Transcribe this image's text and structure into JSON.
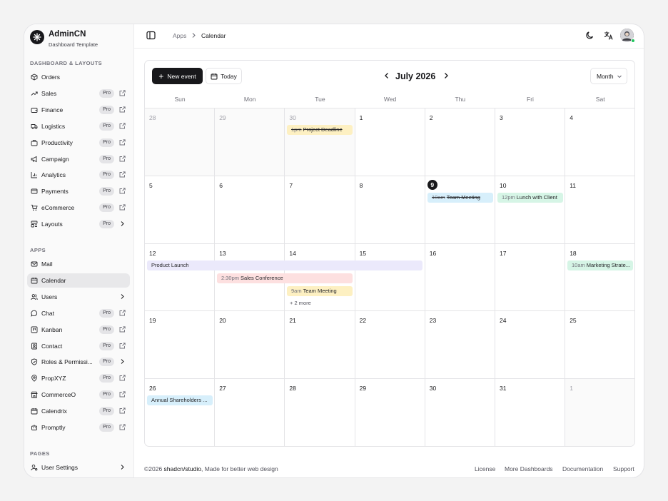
{
  "brand": {
    "name": "AdminCN",
    "subtitle": "Dashboard Template"
  },
  "sidebar": {
    "sections": [
      {
        "title": "DASHBOARD & LAYOUTS"
      },
      {
        "title": "APPS"
      },
      {
        "title": "PAGES"
      }
    ],
    "items": [
      {
        "label": "Orders",
        "icon": "package-icon"
      },
      {
        "label": "Sales",
        "icon": "trending-up-icon",
        "badge": "Pro"
      },
      {
        "label": "Finance",
        "icon": "wallet-icon",
        "badge": "Pro"
      },
      {
        "label": "Logistics",
        "icon": "truck-icon",
        "badge": "Pro"
      },
      {
        "label": "Productivity",
        "icon": "briefcase-icon",
        "badge": "Pro"
      },
      {
        "label": "Campaign",
        "icon": "megaphone-icon",
        "badge": "Pro"
      },
      {
        "label": "Analytics",
        "icon": "bar-chart-icon",
        "badge": "Pro"
      },
      {
        "label": "Payments",
        "icon": "credit-card-icon",
        "badge": "Pro"
      },
      {
        "label": "eCommerce",
        "icon": "cart-icon",
        "badge": "Pro"
      },
      {
        "label": "Layouts",
        "icon": "layout-icon",
        "badge": "Pro"
      },
      {
        "label": "Mail",
        "icon": "mail-icon"
      },
      {
        "label": "Calendar",
        "icon": "calendar-icon"
      },
      {
        "label": "Users",
        "icon": "users-icon"
      },
      {
        "label": "Chat",
        "icon": "chat-icon",
        "badge": "Pro"
      },
      {
        "label": "Kanban",
        "icon": "kanban-icon",
        "badge": "Pro"
      },
      {
        "label": "Contact",
        "icon": "contact-icon",
        "badge": "Pro"
      },
      {
        "label": "Roles & Permissi...",
        "icon": "shield-icon",
        "badge": "Pro"
      },
      {
        "label": "PropXYZ",
        "icon": "map-pin-icon",
        "badge": "Pro"
      },
      {
        "label": "CommerceO",
        "icon": "store-icon",
        "badge": "Pro"
      },
      {
        "label": "Calendrix",
        "icon": "calendar-icon",
        "badge": "Pro"
      },
      {
        "label": "Promptly",
        "icon": "bot-icon",
        "badge": "Pro"
      },
      {
        "label": "User Settings",
        "icon": "user-cog-icon"
      }
    ]
  },
  "header": {
    "breadcrumb": [
      "Apps",
      "Calendar"
    ]
  },
  "calendar": {
    "new_event_label": "New event",
    "today_label": "Today",
    "month_title": "July 2026",
    "view_label": "Month",
    "weekdays": [
      "Sun",
      "Mon",
      "Tue",
      "Wed",
      "Thu",
      "Fri",
      "Sat"
    ],
    "weeks": [
      [
        "28",
        "29",
        "30",
        "1",
        "2",
        "3",
        "4"
      ],
      [
        "5",
        "6",
        "7",
        "8",
        "9",
        "10",
        "11"
      ],
      [
        "12",
        "13",
        "14",
        "15",
        "16",
        "17",
        "18"
      ],
      [
        "19",
        "20",
        "21",
        "22",
        "23",
        "24",
        "25"
      ],
      [
        "26",
        "27",
        "28",
        "29",
        "30",
        "31",
        "1"
      ]
    ],
    "events": [
      {
        "time": "1pm",
        "title": "Project Deadline",
        "color": "#fdf0c2"
      },
      {
        "time": "10am",
        "title": "Team Meeting",
        "color": "#d7effb"
      },
      {
        "time": "12pm",
        "title": "Lunch with Client",
        "color": "#d6f5e6"
      },
      {
        "time": "",
        "title": "Product Launch",
        "color": "#ebe9fb"
      },
      {
        "time": "10am",
        "title": "Marketing Strate...",
        "color": "#d6f5e6"
      },
      {
        "time": "2:30pm",
        "title": "Sales Conference",
        "color": "#fde0e0"
      },
      {
        "time": "9am",
        "title": "Team Meeting",
        "color": "#fdf0c2"
      },
      {
        "time": "",
        "title": "Annual Shareholders ...",
        "color": "#d7effb"
      }
    ],
    "more_label": "+ 2 more"
  },
  "footer": {
    "copyright": "©2026 ",
    "brand": "shadcn/studio",
    "tagline": ", Made for better web design",
    "links": [
      "License",
      "More Dashboards",
      "Documentation",
      "Support"
    ]
  }
}
